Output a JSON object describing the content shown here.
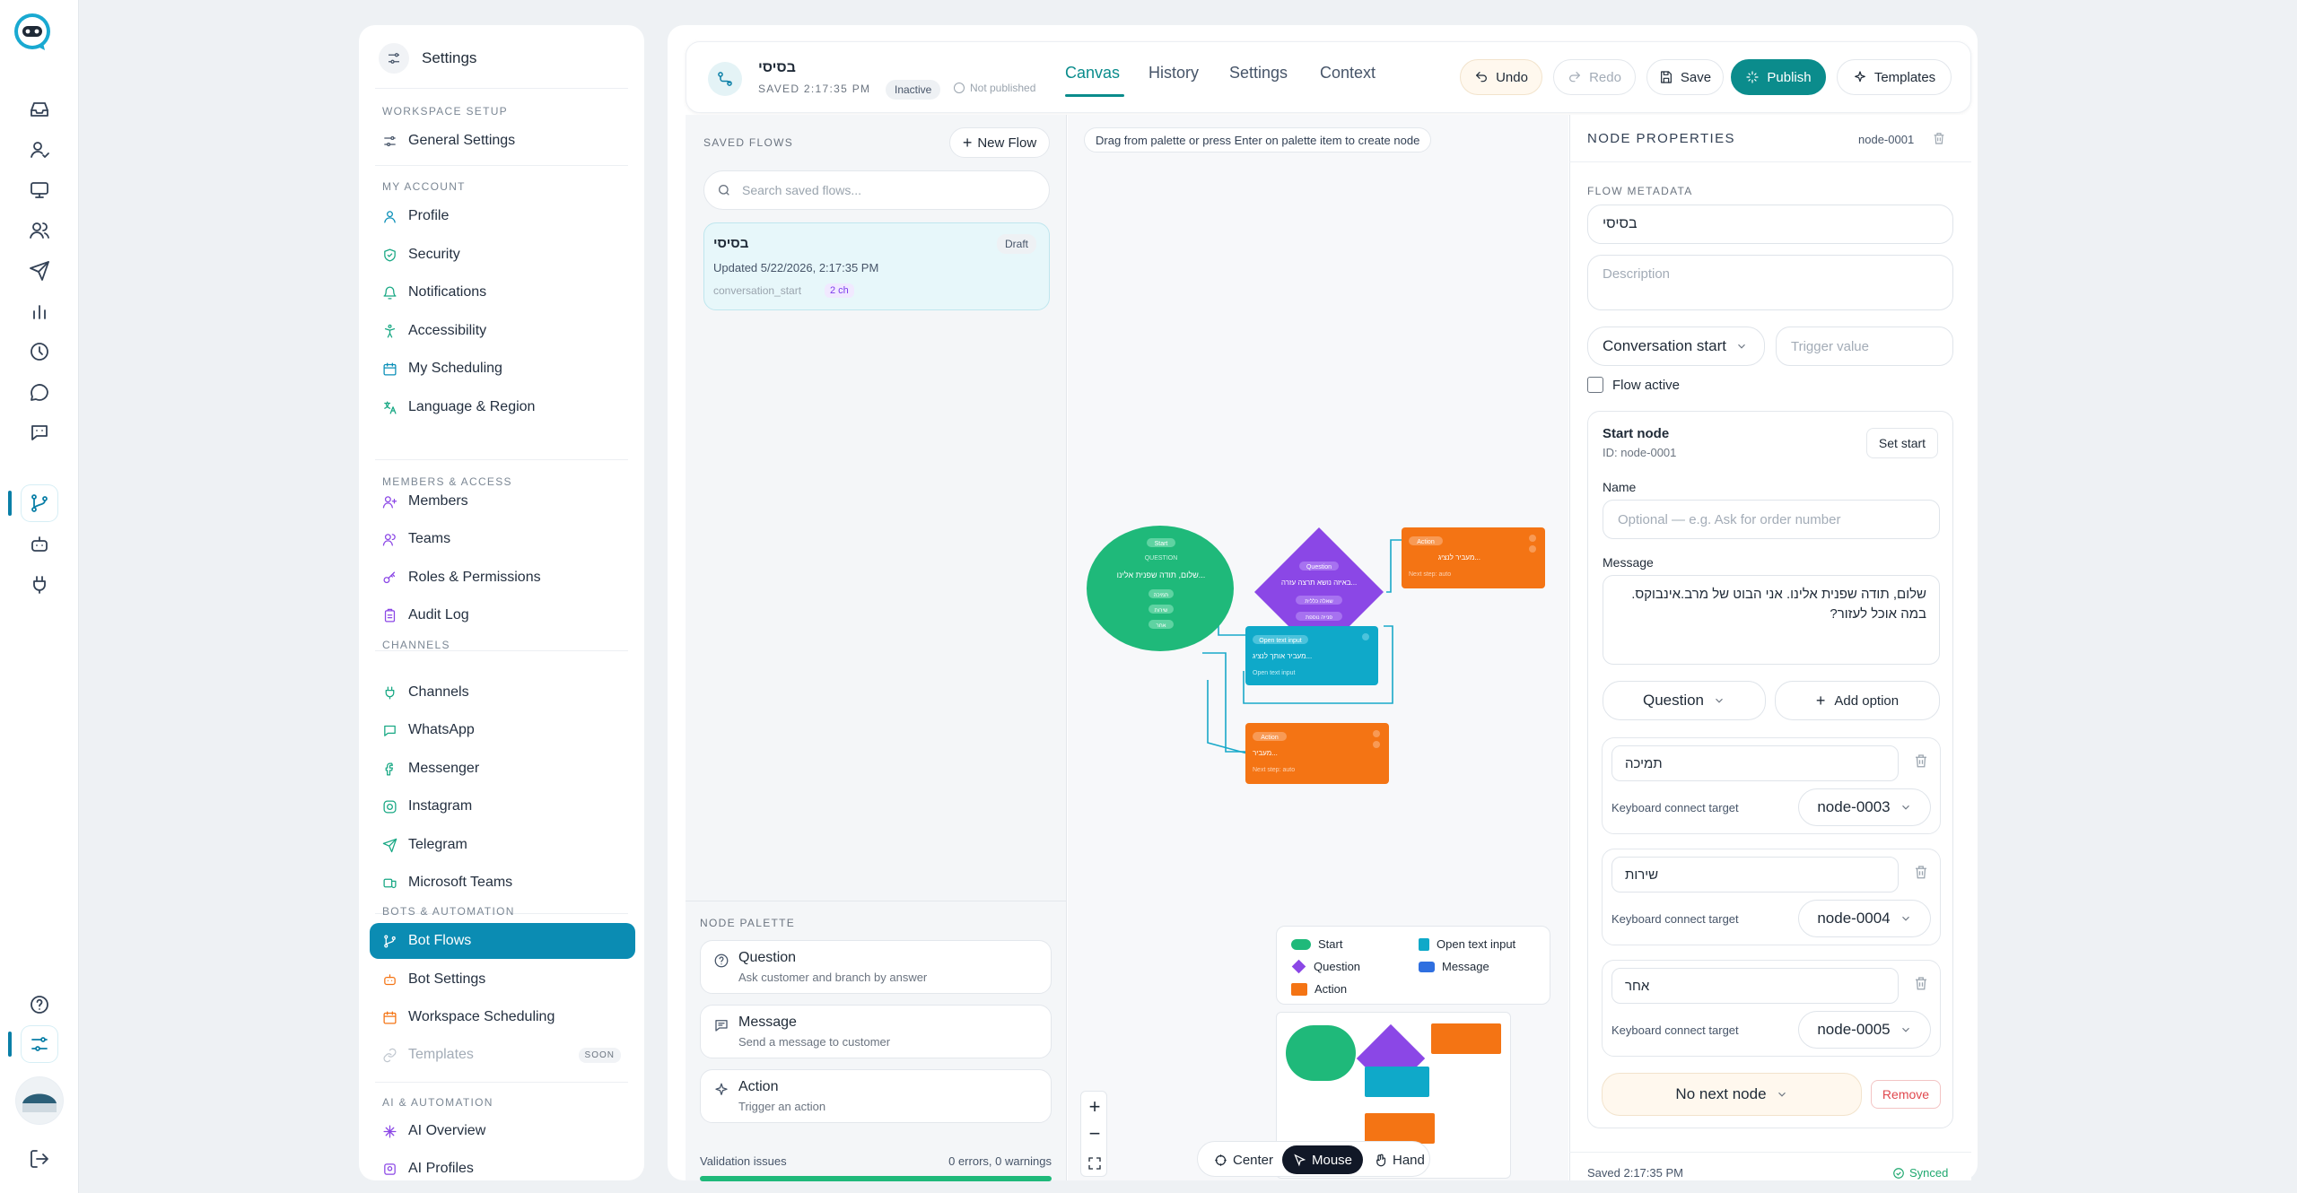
{
  "rail": {
    "items": [
      "logo",
      "inbox-icon",
      "contacts-icon",
      "monitor-icon",
      "users-icon",
      "send-icon",
      "analytics-icon",
      "history-icon",
      "chat-icon",
      "bot-chat-icon",
      "bot-flows-icon",
      "bot-icon",
      "plug-icon"
    ],
    "bottom": [
      "help-icon",
      "settings-icon",
      "avatar",
      "logout-icon"
    ]
  },
  "settings": {
    "title": "Settings",
    "sections": [
      {
        "label": "WORKSPACE SETUP",
        "items": [
          {
            "label": "General Settings",
            "icon": "sliders-icon"
          }
        ]
      },
      {
        "label": "MY ACCOUNT",
        "items": [
          {
            "label": "Profile",
            "icon": "user-icon"
          },
          {
            "label": "Security",
            "icon": "shield-icon"
          },
          {
            "label": "Notifications",
            "icon": "bell-icon"
          },
          {
            "label": "Accessibility",
            "icon": "accessibility-icon"
          },
          {
            "label": "My Scheduling",
            "icon": "calendar-icon"
          },
          {
            "label": "Language & Region",
            "icon": "language-icon"
          }
        ]
      },
      {
        "label": "MEMBERS & ACCESS",
        "items": [
          {
            "label": "Members",
            "icon": "user-plus-icon"
          },
          {
            "label": "Teams",
            "icon": "team-icon"
          },
          {
            "label": "Roles & Permissions",
            "icon": "key-icon"
          },
          {
            "label": "Audit Log",
            "icon": "clipboard-icon"
          }
        ]
      },
      {
        "label": "CHANNELS",
        "items": [
          {
            "label": "Channels",
            "icon": "plug-icon"
          },
          {
            "label": "WhatsApp",
            "icon": "whatsapp-icon"
          },
          {
            "label": "Messenger",
            "icon": "messenger-icon"
          },
          {
            "label": "Instagram",
            "icon": "instagram-icon"
          },
          {
            "label": "Telegram",
            "icon": "telegram-icon"
          },
          {
            "label": "Microsoft Teams",
            "icon": "teams-icon"
          }
        ]
      },
      {
        "label": "BOTS & AUTOMATION",
        "items": [
          {
            "label": "Bot Flows",
            "icon": "flow-icon",
            "active": true
          },
          {
            "label": "Bot Settings",
            "icon": "bot-icon"
          },
          {
            "label": "Workspace Scheduling",
            "icon": "calendar-icon"
          },
          {
            "label": "Templates",
            "icon": "link-icon",
            "badge": "SOON",
            "disabled": true
          }
        ]
      },
      {
        "label": "AI & AUTOMATION",
        "items": [
          {
            "label": "AI Overview",
            "icon": "ai-icon"
          },
          {
            "label": "AI Profiles",
            "icon": "ai-profile-icon"
          }
        ]
      }
    ]
  },
  "topbar": {
    "flow_name": "בסיסי",
    "saved": "SAVED 2:17:35 PM",
    "status": "Inactive",
    "publish_status": "Not published",
    "tabs": [
      "Canvas",
      "History",
      "Settings",
      "Context"
    ],
    "active_tab": "Canvas",
    "buttons": {
      "undo": "Undo",
      "redo": "Redo",
      "save": "Save",
      "publish": "Publish",
      "templates": "Templates"
    }
  },
  "flows": {
    "title": "SAVED FLOWS",
    "new_flow": "New Flow",
    "search_placeholder": "Search saved flows...",
    "card": {
      "name": "בסיסי",
      "badge": "Draft",
      "updated": "Updated 5/22/2026, 2:17:35 PM",
      "trigger": "conversation_start",
      "channels": "2 ch"
    },
    "palette_title": "NODE PALETTE",
    "palette": [
      {
        "title": "Question",
        "desc": "Ask customer and branch by answer",
        "icon": "question-icon"
      },
      {
        "title": "Message",
        "desc": "Send a message to customer",
        "icon": "message-icon"
      },
      {
        "title": "Action",
        "desc": "Trigger an action",
        "icon": "sparkle-icon"
      }
    ],
    "validation_label": "Validation issues",
    "validation_value": "0 errors, 0 warnings"
  },
  "canvas": {
    "hint": "Drag from palette or press Enter on palette item to create node",
    "legend": [
      {
        "label": "Start",
        "color": "#1fb97a",
        "shape": "pill"
      },
      {
        "label": "Open text input",
        "color": "#0fa9c9",
        "shape": "doc"
      },
      {
        "label": "Question",
        "color": "#8b47e6",
        "shape": "diamond"
      },
      {
        "label": "Message",
        "color": "#2f6fe0",
        "shape": "chat"
      },
      {
        "label": "Action",
        "color": "#f47414",
        "shape": "square"
      }
    ],
    "modes": {
      "center": "Center",
      "mouse": "Mouse",
      "hand": "Hand"
    },
    "nodes": {
      "start": {
        "tag": "Start",
        "kind": "QUESTION",
        "text": "שלום, תודה שפנית אלינו...",
        "opts": [
          "תמיכה",
          "שירות",
          "אחר"
        ]
      },
      "question": {
        "tag": "Question",
        "text": "באיזה נושא תרצה עזרה...",
        "opts": [
          "שאלה כללית",
          "פנייה נוספת"
        ]
      },
      "action1": {
        "tag": "Action",
        "text": "מעביר לנציג...",
        "sub": "Next step: auto"
      },
      "open_text": {
        "tag": "Open text input",
        "text": "מעביר אותך לנציג...",
        "sub": "Open text input"
      },
      "action2": {
        "tag": "Action",
        "text": "מעביר...",
        "sub": "Next step: auto"
      }
    }
  },
  "props": {
    "title": "NODE PROPERTIES",
    "node_id": "node-0001",
    "meta_label": "FLOW METADATA",
    "flow_name_value": "בסיסי",
    "description_placeholder": "Description",
    "trigger_select": "Conversation start",
    "trigger_placeholder": "Trigger value",
    "flow_active": "Flow active",
    "start_node_title": "Start node",
    "start_node_id": "ID: node-0001",
    "set_start": "Set start",
    "name_label": "Name",
    "name_placeholder": "Optional — e.g. Ask for order number",
    "message_label": "Message",
    "message_value": "שלום, תודה שפנית אלינו. אני הבוט של מרב.אינבוקס. במה אוכל לעזור?",
    "type_select": "Question",
    "add_option": "Add option",
    "options": [
      {
        "value": "תמיכה",
        "target_label": "Keyboard connect target",
        "target": "node-0003"
      },
      {
        "value": "שירות",
        "target_label": "Keyboard connect target",
        "target": "node-0004"
      },
      {
        "value": "אחר",
        "target_label": "Keyboard connect target",
        "target": "node-0005"
      }
    ],
    "next_node": "No next node",
    "remove": "Remove",
    "footer_saved": "Saved 2:17:35 PM",
    "footer_synced": "Synced"
  }
}
